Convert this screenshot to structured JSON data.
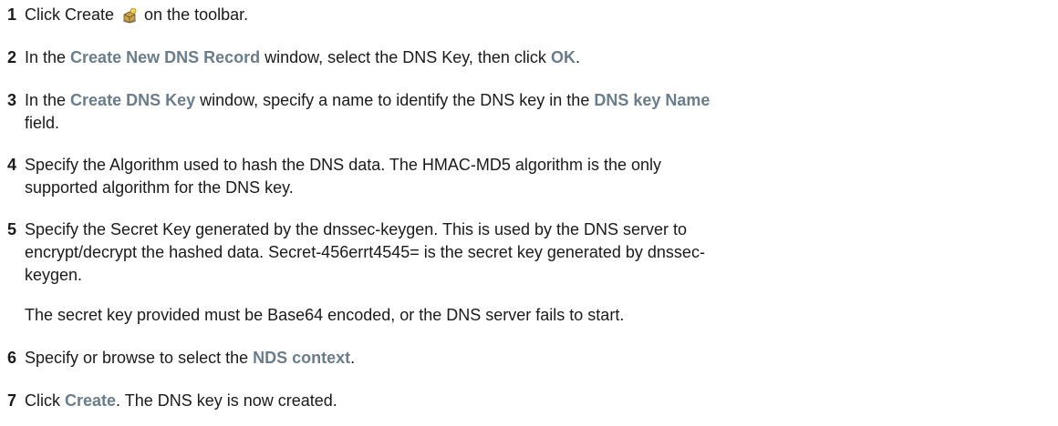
{
  "steps": [
    {
      "number": "1",
      "before_icon": "Click Create ",
      "icon": "create-icon",
      "after_icon": " on the toolbar."
    },
    {
      "number": "2",
      "t1": "In the ",
      "ui1": "Create New DNS Record",
      "t2": " window, select the DNS Key, then click ",
      "ui2": "OK",
      "t3": "."
    },
    {
      "number": "3",
      "t1": "In the ",
      "ui1": "Create DNS Key",
      "t2": " window, specify a name to identify the DNS key in the ",
      "ui2": "DNS key Name",
      "t3": "field."
    },
    {
      "number": "4",
      "line1": "Specify the Algorithm used to hash the DNS data. The HMAC-MD5 algorithm is the only",
      "line2": "supported algorithm for the DNS key."
    },
    {
      "number": "5",
      "line1": "Specify the Secret Key generated by the dnssec-keygen. This is used by the DNS server to",
      "line2": "encrypt/decrypt the hashed data.  Secret-456errt4545= is the secret key generated by dnssec-",
      "line3": "keygen.",
      "note": "The secret key provided must be Base64 encoded, or the DNS server fails to start."
    },
    {
      "number": "6",
      "t1": "Specify or browse to select the ",
      "ui1": "NDS context",
      "t2": "."
    },
    {
      "number": "7",
      "t1": "Click ",
      "ui1": "Create",
      "t2": ". The DNS key is now created."
    }
  ],
  "colors": {
    "text": "#1a1a1a",
    "ui_reference": "#6a7d8c"
  }
}
